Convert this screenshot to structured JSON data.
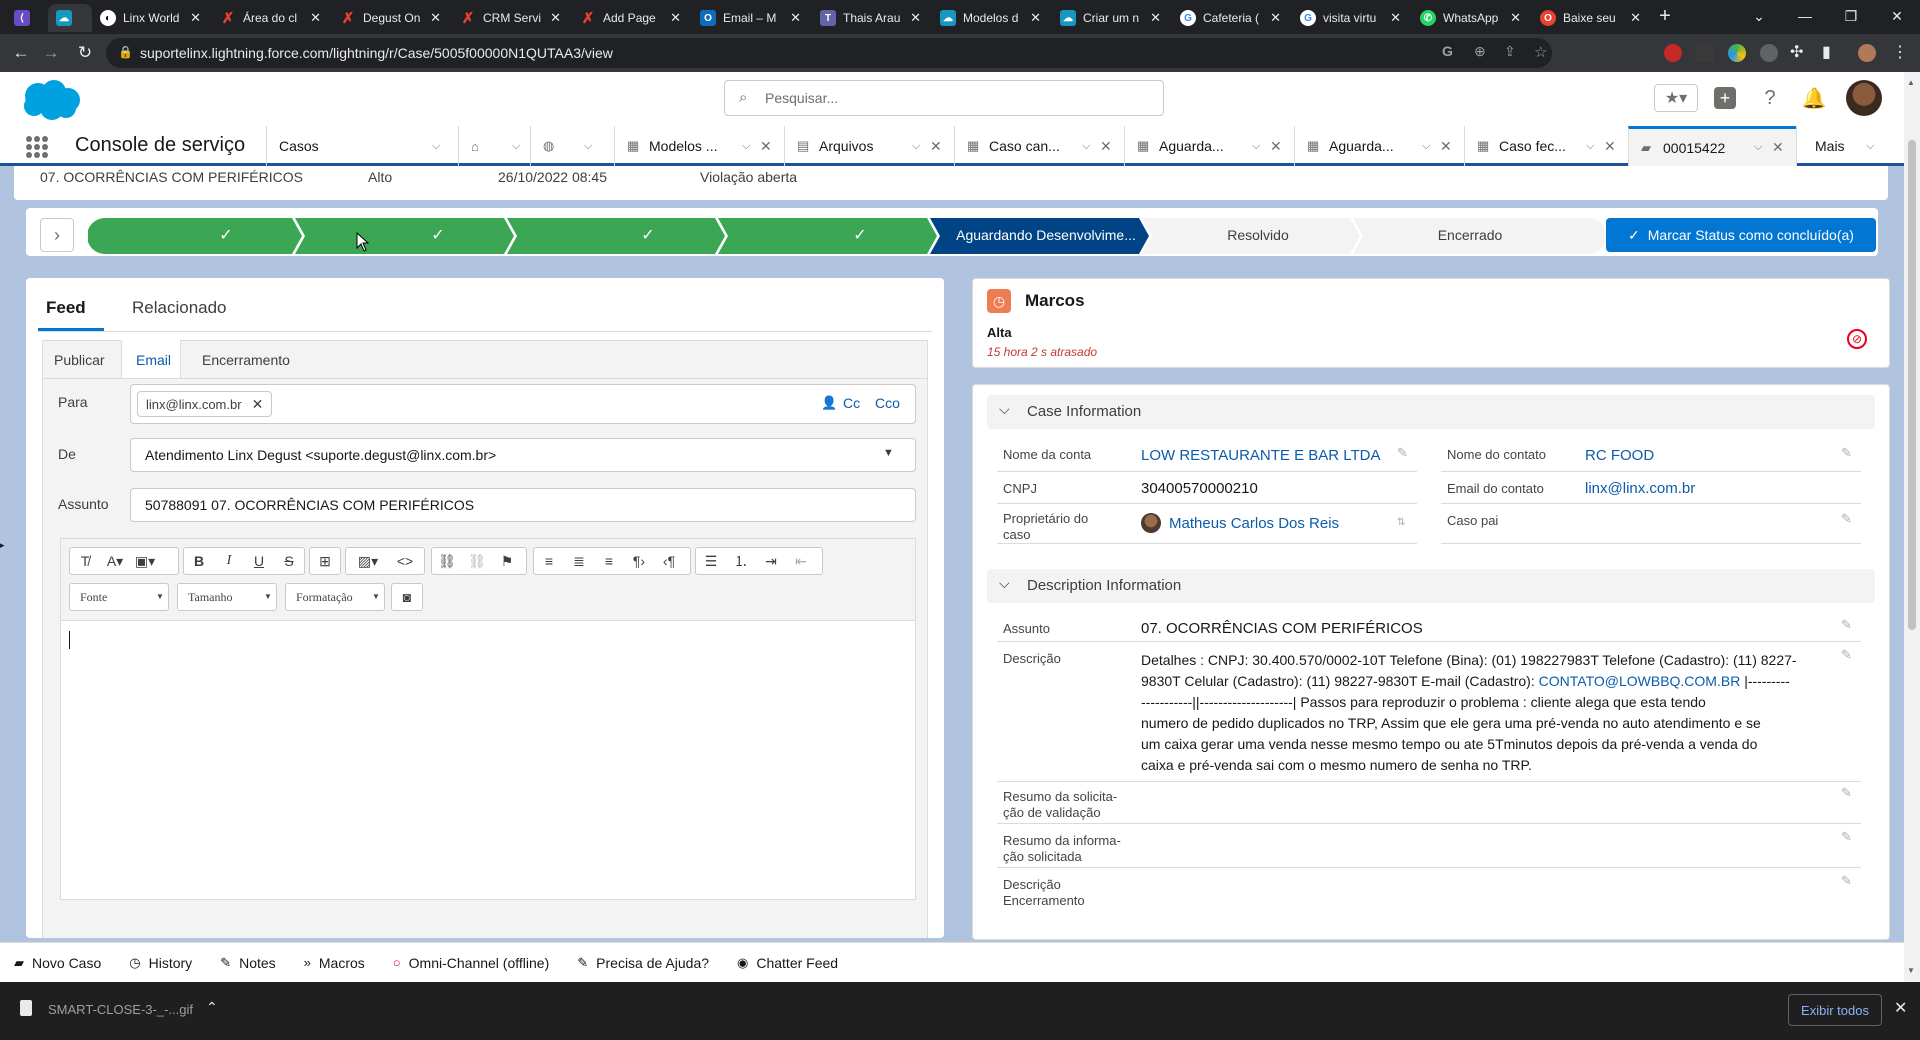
{
  "browser": {
    "tabs": [
      {
        "label": "",
        "icon": "linx-icon",
        "color": "#6a4cc2"
      },
      {
        "label": "",
        "icon": "salesforce-icon",
        "color": "#1798c1",
        "active": true
      },
      {
        "label": "Linx World",
        "icon": "linx-icon",
        "color": "#fff"
      },
      {
        "label": "Área do cl",
        "icon": "pointer-icon",
        "color": "#e8412c"
      },
      {
        "label": "Degust On",
        "icon": "pointer-icon",
        "color": "#e8412c"
      },
      {
        "label": "CRM Servi",
        "icon": "pointer-icon",
        "color": "#e8412c"
      },
      {
        "label": "Add Page",
        "icon": "pointer-icon",
        "color": "#e8412c"
      },
      {
        "label": "Email – M",
        "icon": "outlook-icon",
        "color": "#0f6cbd"
      },
      {
        "label": "Thais Arau",
        "icon": "teams-icon",
        "color": "#6264a7"
      },
      {
        "label": "Modelos d",
        "icon": "salesforce-icon",
        "color": "#1798c1"
      },
      {
        "label": "Criar um n",
        "icon": "salesforce-icon",
        "color": "#1798c1"
      },
      {
        "label": "Cafeteria (",
        "icon": "google-icon",
        "color": "#fff"
      },
      {
        "label": "visita virtu",
        "icon": "google-icon",
        "color": "#fff"
      },
      {
        "label": "WhatsApp",
        "icon": "whatsapp-icon",
        "color": "#25d366"
      },
      {
        "label": "Baixe seu",
        "icon": "opera-icon",
        "color": "#e8412c"
      }
    ],
    "url": "suportelinx.lightning.force.com/lightning/r/Case/5005f00000N1QUTAA3/view"
  },
  "header": {
    "search_placeholder": "Pesquisar..."
  },
  "console": {
    "app_name": "Console de serviço",
    "object_tab": "Casos",
    "tabs": [
      {
        "label": "",
        "icon": "briefcase-icon"
      },
      {
        "label": "",
        "icon": "compass-icon"
      },
      {
        "label": "Modelos ...",
        "icon": "table-icon"
      },
      {
        "label": "Arquivos",
        "icon": "files-icon"
      },
      {
        "label": "Caso can...",
        "icon": "table-icon"
      },
      {
        "label": "Aguarda...",
        "icon": "table-icon"
      },
      {
        "label": "Aguarda...",
        "icon": "table-icon"
      },
      {
        "label": "Caso fec...",
        "icon": "table-icon"
      },
      {
        "label": "00015422",
        "icon": "case-icon",
        "active": true
      }
    ],
    "more_label": "Mais"
  },
  "highlights": {
    "subject": "07. OCORRÊNCIAS COM PERIFÉRICOS",
    "priority": "Alto",
    "date": "26/10/2022 08:45",
    "status": "Violação aberta"
  },
  "path": {
    "current": "Aguardando Desenvolvime...",
    "next1": "Resolvido",
    "next2": "Encerrado",
    "mark_button": "Marcar Status como concluído(a)",
    "check": "✓"
  },
  "feed": {
    "tab_feed": "Feed",
    "tab_related": "Relacionado",
    "action_publish": "Publicar",
    "action_email": "Email",
    "action_close": "Encerramento",
    "to_label": "Para",
    "to_pill": "linx@linx.com.br",
    "cc": "Cc",
    "bcc": "Cco",
    "from_label": "De",
    "from_value": "Atendimento Linx Degust <suporte.degust@linx.com.br>",
    "subject_label": "Assunto",
    "subject_value": "50788091 07. OCORRÊNCIAS COM PERIFÉRICOS",
    "font_dd": "Fonte",
    "size_dd": "Tamanho",
    "format_dd": "Formatação"
  },
  "milestones": {
    "title": "Marcos",
    "priority": "Alta",
    "overdue": "15 hora 2 s atrasado"
  },
  "case_info": {
    "section": "Case Information",
    "account_label": "Nome da conta",
    "account_value": "LOW RESTAURANTE E BAR LTDA",
    "contact_label": "Nome do contato",
    "contact_value": "RC FOOD",
    "cnpj_label": "CNPJ",
    "cnpj_value": "30400570000210",
    "email_label": "Email do contato",
    "email_value": "linx@linx.com.br",
    "owner_label_1": "Proprietário do",
    "owner_label_2": "caso",
    "owner_value": "Matheus Carlos Dos Reis",
    "parent_label": "Caso pai"
  },
  "description_info": {
    "section": "Description Information",
    "subject_label": "Assunto",
    "subject_value": "07. OCORRÊNCIAS COM PERIFÉRICOS",
    "desc_label": "Descrição",
    "desc_line1": "Detalhes : CNPJ: 30.400.570/0002-10T Telefone (Bina): (01) 198227983T Telefone (Cadastro): (11) 8227-",
    "desc_line2a": "9830T Celular (Cadastro): (11) 98227-9830T E-mail (Cadastro): ",
    "desc_line2_link": "CONTATO@LOWBBQ.COM.BR",
    "desc_line2b": " |---------",
    "desc_line3": "-----------||--------------------| Passos para reproduzir o problema : cliente alega que esta tendo",
    "desc_line4": "numero de pedido duplicados no TRP, Assim que ele gera uma pré-venda no auto atendimento e se",
    "desc_line5": "um caixa gerar uma venda nesse mesmo tempo ou ate 5Tminutos depois da pré-venda a venda do",
    "desc_line6": "caixa e pré-venda sai com o mesmo numero de senha no TRP.",
    "resumo_val_1": "Resumo da solicita-",
    "resumo_val_2": "ção de validação",
    "resumo_inf_1": "Resumo da informa-",
    "resumo_inf_2": "ção solicitada",
    "desc_close_1": "Descrição",
    "desc_close_2": "Encerramento"
  },
  "utility_bar": [
    {
      "label": "Novo Caso",
      "icon": "case-icon"
    },
    {
      "label": "History",
      "icon": "clock-icon"
    },
    {
      "label": "Notes",
      "icon": "notes-icon"
    },
    {
      "label": "Macros",
      "icon": "macros-icon"
    },
    {
      "label": "Omni-Channel (offline)",
      "icon": "omni-icon"
    },
    {
      "label": "Precisa de Ajuda?",
      "icon": "help-icon"
    },
    {
      "label": "Chatter Feed",
      "icon": "chat-icon"
    }
  ],
  "downloads": {
    "file": "SMART-CLOSE-3-_-...gif",
    "show_all": "Exibir todos"
  }
}
